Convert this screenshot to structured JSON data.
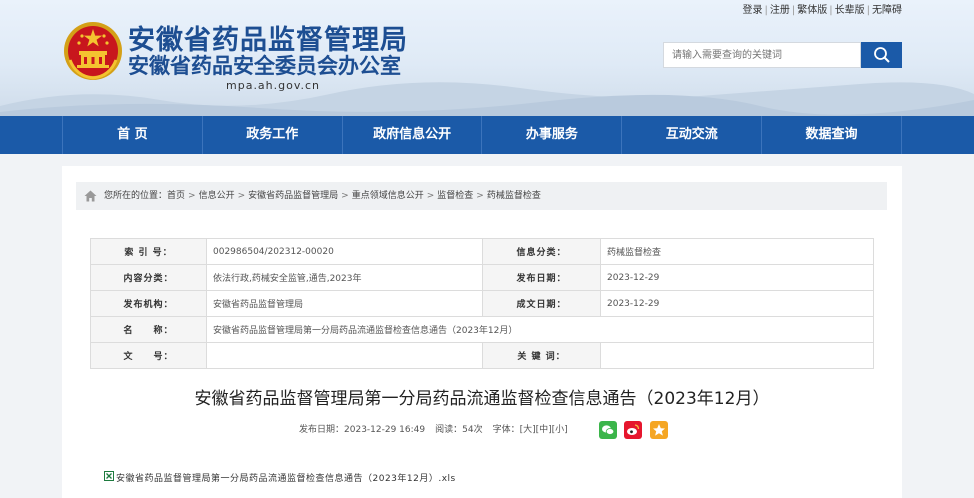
{
  "header": {
    "title_line1": "安徽省药品监督管理局",
    "title_line2": "安徽省药品安全委员会办公室",
    "domain": "mpa.ah.gov.cn",
    "top_links": [
      "登录",
      "注册",
      "繁体版",
      "长辈版",
      "无障碍"
    ],
    "search_placeholder": "请输入需要查询的关键词",
    "brand_color": "#1b5aa8"
  },
  "nav": {
    "items": [
      "首 页",
      "政务工作",
      "政府信息公开",
      "办事服务",
      "互动交流",
      "数据查询"
    ]
  },
  "breadcrumb": {
    "prefix": "您所在的位置：",
    "items": [
      "首页",
      "信息公开",
      "安徽省药品监督管理局",
      "重点领域信息公开",
      "监督检查",
      "药械监督检查"
    ],
    "separator": ">"
  },
  "meta_table": {
    "index_label": "索 引 号：",
    "index_value": "002986504/202312-00020",
    "category_label": "信息分类：",
    "category_value": "药械监督检查",
    "content_label": "内容分类：",
    "content_value": "依法行政,药械安全监管,通告,2023年",
    "pubdate_label": "发布日期：",
    "pubdate_value": "2023-12-29",
    "org_label": "发布机构：",
    "org_value": "安徽省药品监督管理局",
    "gendate_label": "成文日期：",
    "gendate_value": "2023-12-29",
    "name_label": "名　　称：",
    "name_value": "安徽省药品监督管理局第一分局药品流通监督检查信息通告（2023年12月）",
    "docno_label": "文　　号：",
    "docno_value": "",
    "keywords_label": "关 键 词：",
    "keywords_value": ""
  },
  "article": {
    "title": "安徽省药品监督管理局第一分局药品流通监督检查信息通告（2023年12月）",
    "date_label": "发布日期：",
    "date_value": "2023-12-29 16:49",
    "views_label": "阅读：",
    "views_value": "54次",
    "font_label": "字体：",
    "font_large": "[大]",
    "font_medium": "[中]",
    "font_small": "[小]",
    "share_icons": [
      "wechat-icon",
      "weibo-icon",
      "qzone-icon"
    ],
    "attachment": "安徽省药品监督管理局第一分局药品流通监督检查信息通告（2023年12月）.xls"
  }
}
